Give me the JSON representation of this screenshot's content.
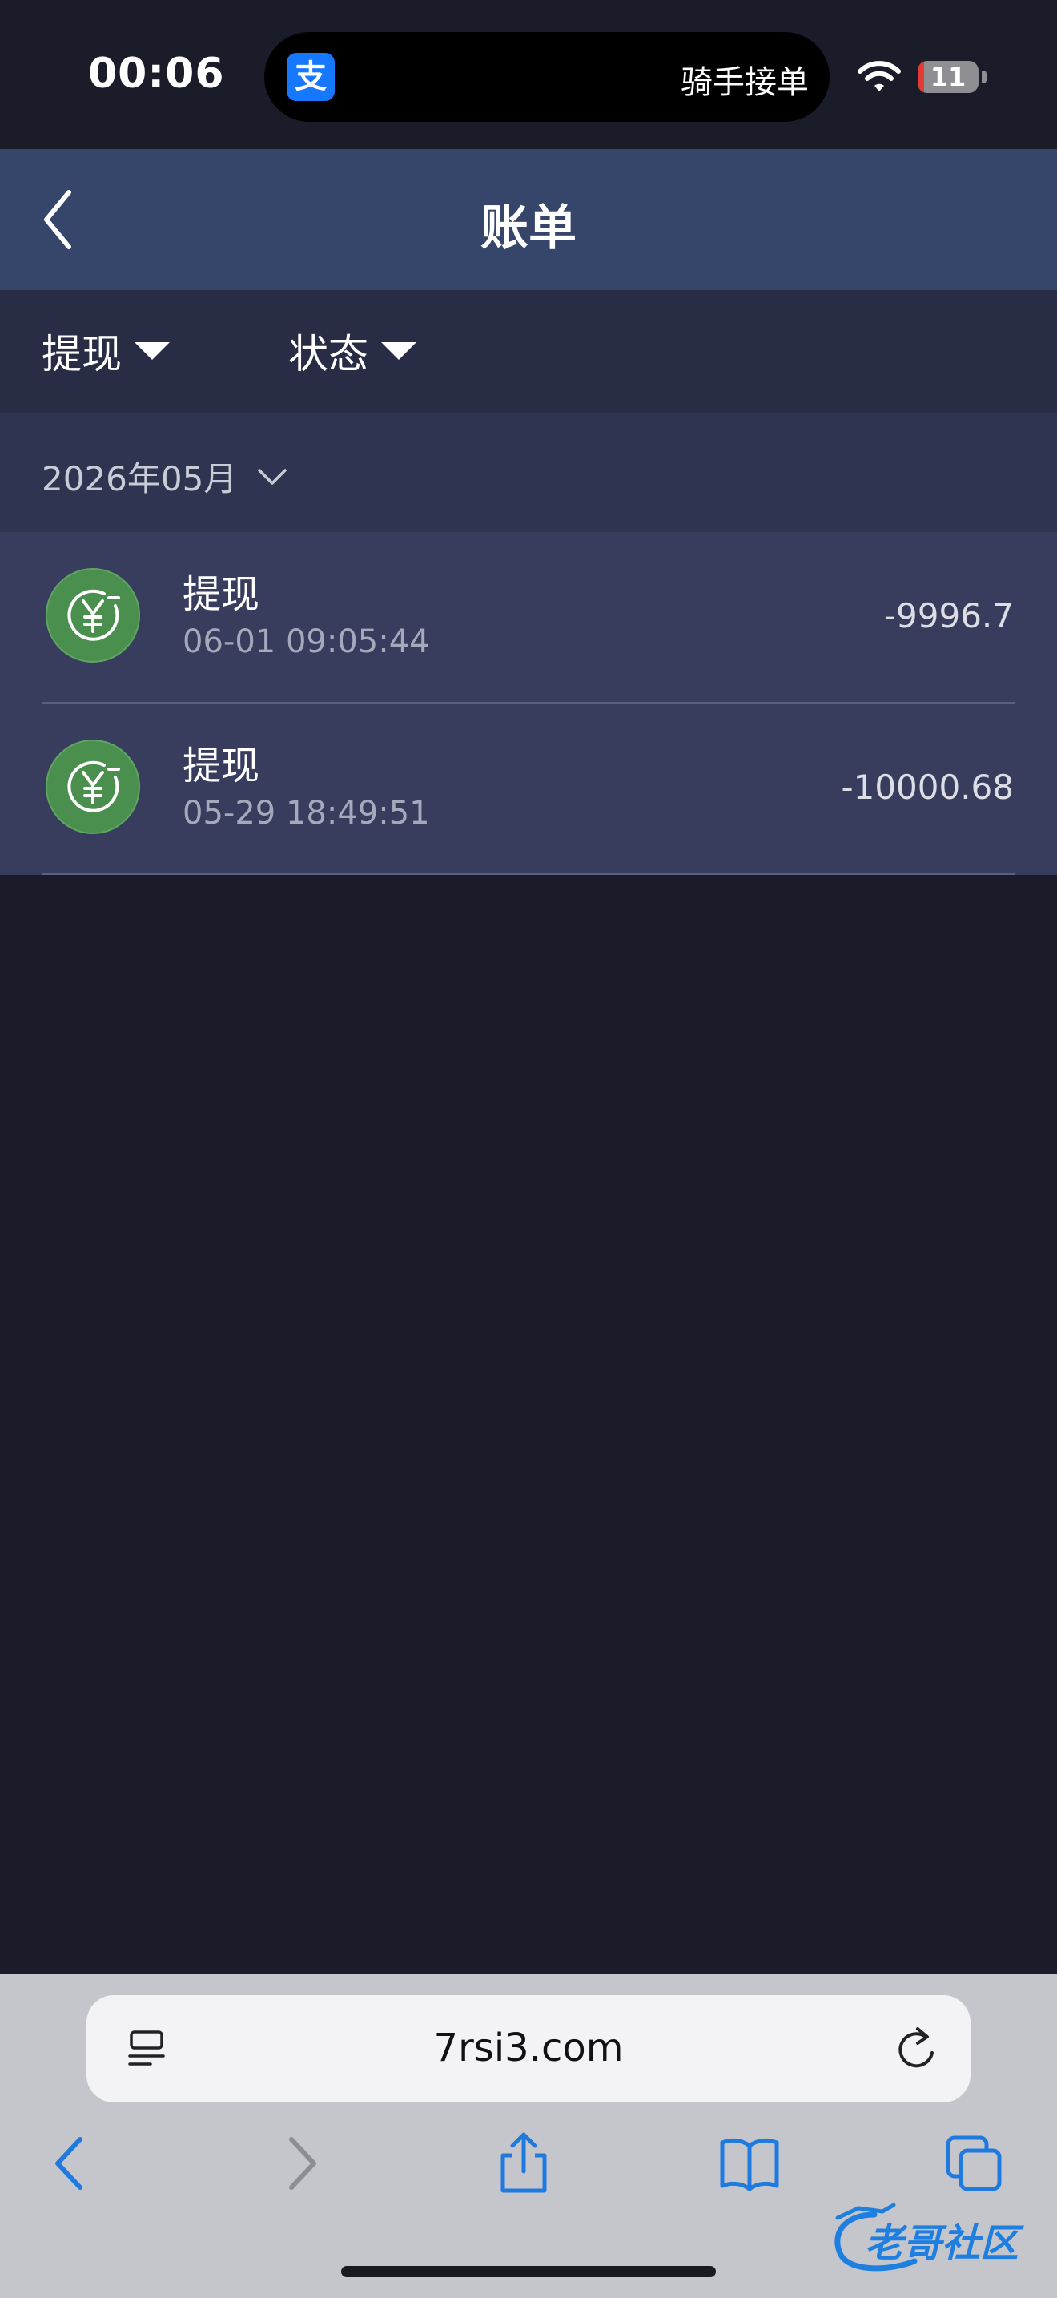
{
  "status_bar": {
    "time": "00:06",
    "island_app_icon_glyph": "支",
    "island_label": "骑手接单",
    "battery_level": "11",
    "battery_fraction": 0.11,
    "icons": [
      "wifi-icon",
      "battery-icon"
    ]
  },
  "nav": {
    "title": "账单",
    "back_icon": "chevron-left-icon"
  },
  "filters": [
    {
      "label": "提现"
    },
    {
      "label": "状态"
    }
  ],
  "month": {
    "label": "2026年05月"
  },
  "transactions": [
    {
      "title": "提现",
      "time": "06-01 09:05:44",
      "amount": "-9996.7",
      "icon": "withdraw-yuan-icon"
    },
    {
      "title": "提现",
      "time": "05-29 18:49:51",
      "amount": "-10000.68",
      "icon": "withdraw-yuan-icon"
    }
  ],
  "browser": {
    "url": "7rsi3.com",
    "toolbar_icons": [
      "back-icon",
      "forward-icon",
      "share-icon",
      "bookmarks-icon",
      "tabs-icon"
    ]
  },
  "watermark": {
    "text": "老哥社区"
  },
  "colors": {
    "background": "#1b1c2a",
    "nav": "#36466a",
    "filter_bar": "#282c44",
    "month_bar": "#2f3551",
    "list": "#383d5e",
    "icon_green": "#4a8f4e",
    "safari_blue": "#1f7ae0"
  }
}
